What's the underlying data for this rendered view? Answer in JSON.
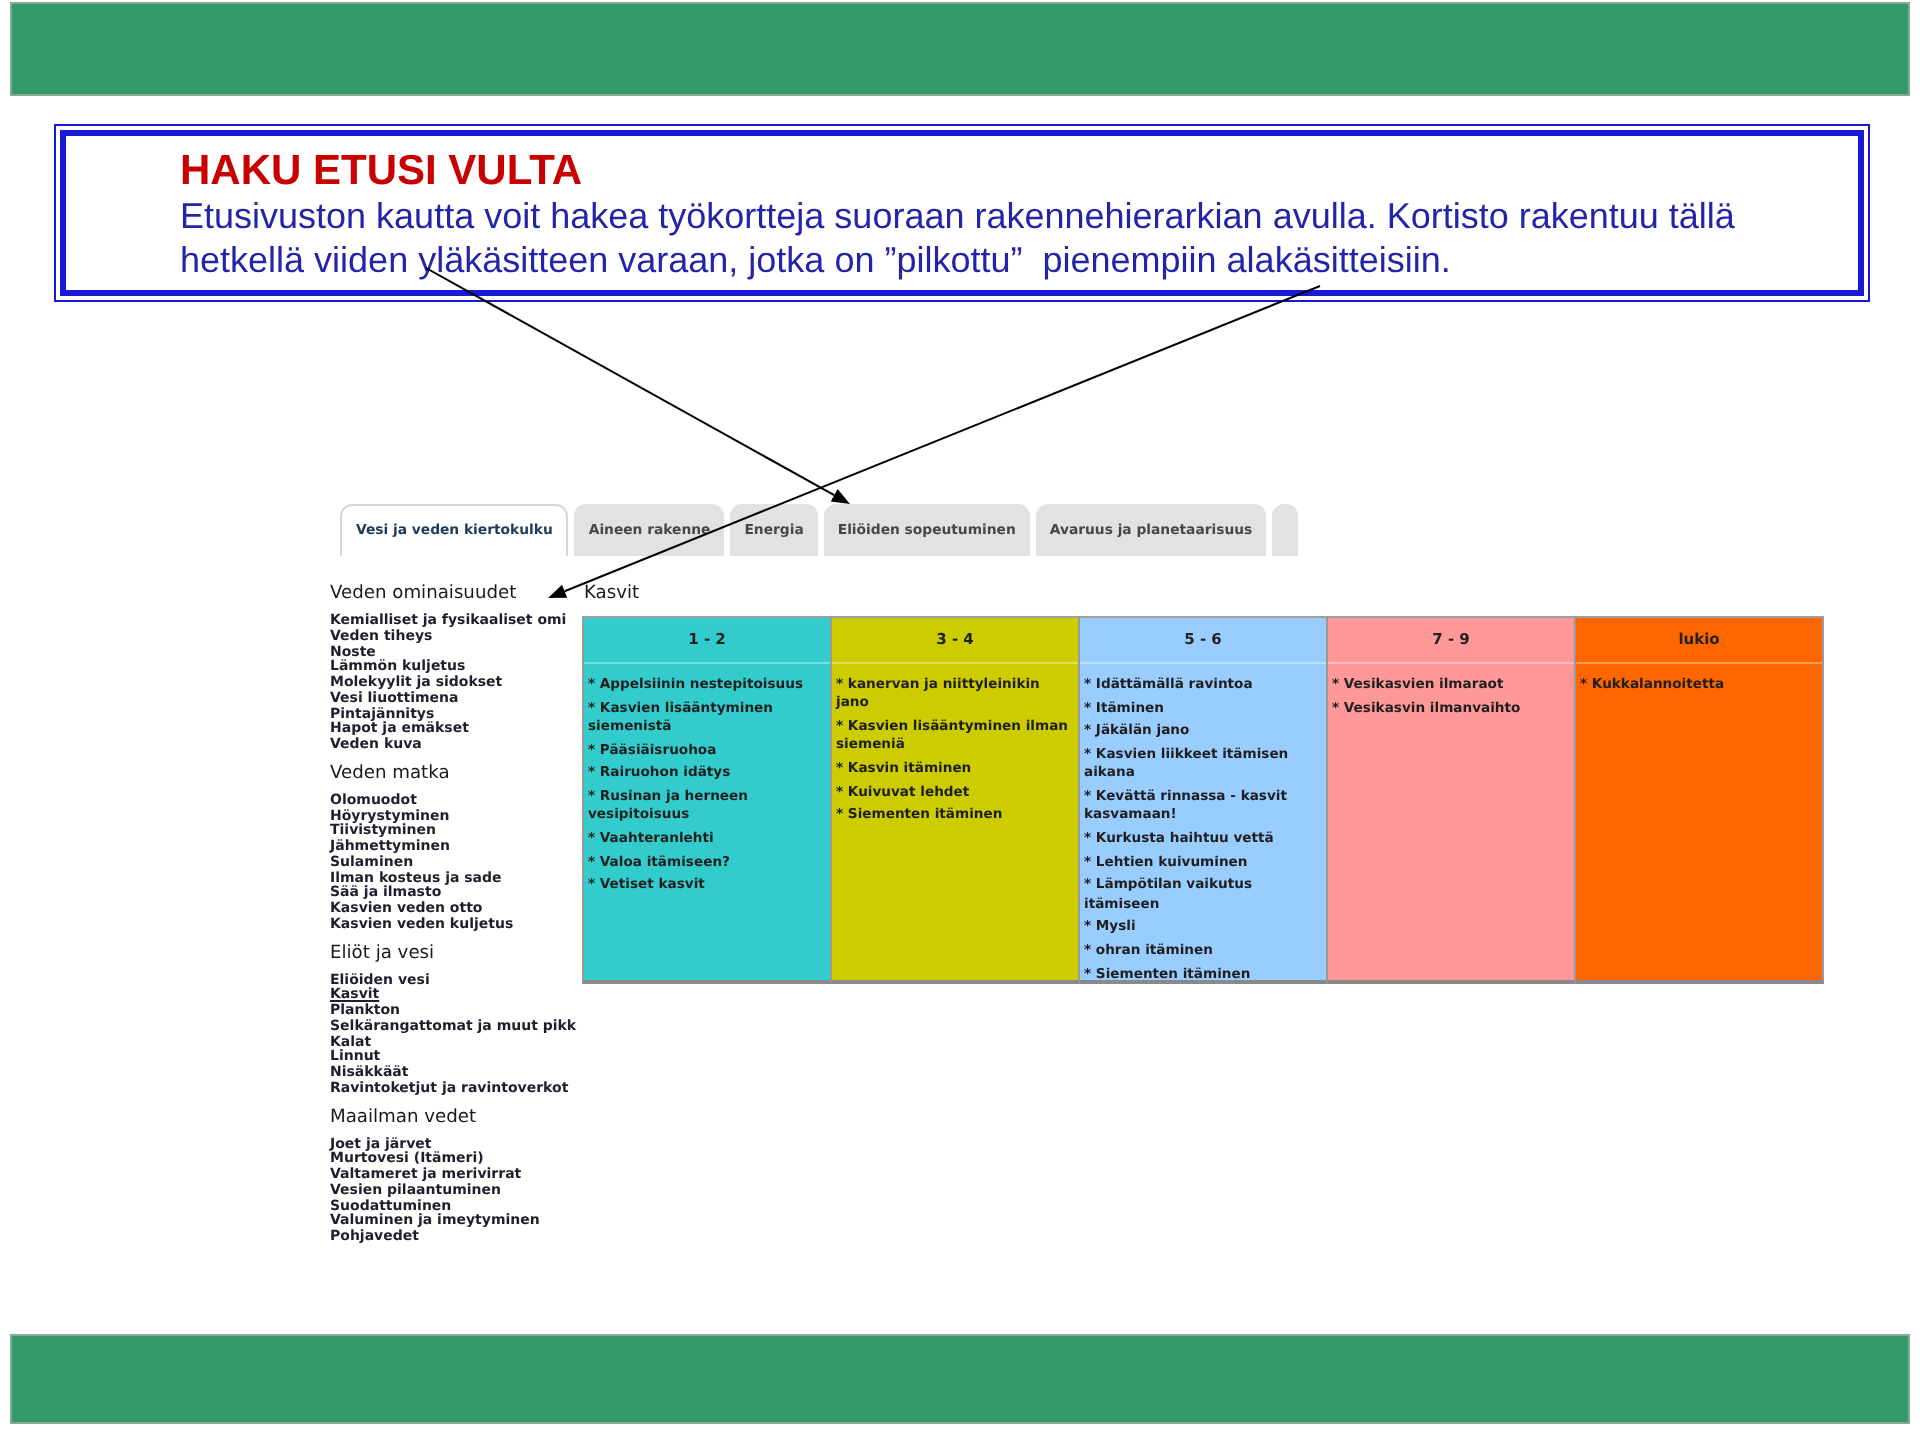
{
  "slide": {
    "title": "HAKU ETUSI VULTA",
    "text": "Etusivuston kautta voit hakea työkortteja suoraan rakennehierarkian avulla. Kortisto rakentuu tällä hetkellä viiden yläkäsitteen varaan, jotka on ”pilkottu”  pienempiin alakäsitteisiin."
  },
  "screenshot": {
    "tabs": [
      {
        "kind": "tab",
        "label": "Vesi ja veden kiertokulku",
        "selected": true
      },
      {
        "kind": "tab",
        "label": "Aineen rakenne",
        "selected": false
      },
      {
        "kind": "tab",
        "label": "Energia",
        "selected": false
      },
      {
        "kind": "tab",
        "label": "Eliöiden sopeutuminen",
        "selected": false
      },
      {
        "kind": "tab",
        "label": "Avaruus ja planetaarisuus",
        "selected": false
      },
      {
        "kind": "cut",
        "selected": false
      }
    ],
    "sidebar": [
      {
        "heading": "Veden ominaisuudet",
        "items": [
          {
            "label": "Kemialliset ja fysikaaliset omi",
            "selected": false
          },
          {
            "label": "Veden tiheys",
            "selected": false
          },
          {
            "label": "Noste",
            "selected": false
          },
          {
            "label": "Lämmön kuljetus",
            "selected": false
          },
          {
            "label": "Molekyylit ja sidokset",
            "selected": false
          },
          {
            "label": "Vesi liuottimena",
            "selected": false
          },
          {
            "label": "Pintajännitys",
            "selected": false
          },
          {
            "label": "Hapot ja emäkset",
            "selected": false
          },
          {
            "label": "Veden kuva",
            "selected": false
          }
        ]
      },
      {
        "heading": "Veden matka",
        "items": [
          {
            "label": "Olomuodot",
            "selected": false
          },
          {
            "label": "Höyrystyminen",
            "selected": false
          },
          {
            "label": "Tiivistyminen",
            "selected": false
          },
          {
            "label": "Jähmettyminen",
            "selected": false
          },
          {
            "label": "Sulaminen",
            "selected": false
          },
          {
            "label": "Ilman kosteus ja sade",
            "selected": false
          },
          {
            "label": "Sää ja ilmasto",
            "selected": false
          },
          {
            "label": "Kasvien veden otto",
            "selected": false
          },
          {
            "label": "Kasvien veden kuljetus",
            "selected": false
          }
        ]
      },
      {
        "heading": "Eliöt ja vesi",
        "items": [
          {
            "label": "Eliöiden vesi",
            "selected": false
          },
          {
            "label": "Kasvit",
            "selected": true
          },
          {
            "label": "Plankton",
            "selected": false
          },
          {
            "label": "Selkärangattomat ja muut pikk",
            "selected": false
          },
          {
            "label": "Kalat",
            "selected": false
          },
          {
            "label": "Linnut",
            "selected": false
          },
          {
            "label": "Nisäkkäät",
            "selected": false
          },
          {
            "label": "Ravintoketjut ja ravintoverkot",
            "selected": false
          }
        ]
      },
      {
        "heading": "Maailman vedet",
        "items": [
          {
            "label": "Joet ja järvet",
            "selected": false
          },
          {
            "label": "Murtovesi (Itämeri)",
            "selected": false
          },
          {
            "label": "Valtameret ja merivirrat",
            "selected": false
          },
          {
            "label": "Vesien pilaantuminen",
            "selected": false
          },
          {
            "label": "Suodattuminen",
            "selected": false
          },
          {
            "label": "Valuminen ja imeytyminen",
            "selected": false
          },
          {
            "label": "Pohjavedet",
            "selected": false
          }
        ]
      }
    ],
    "topic": "Kasvit",
    "columns": [
      {
        "heading": "1 - 2",
        "color": "#33cccc",
        "items": [
          "* Appelsiinin nestepitoisuus",
          "* Kasvien lisääntyminen siemenistä",
          "* Pääsiäisruohoa",
          "* Rairuohon idätys",
          "* Rusinan ja herneen vesipitoisuus",
          "* Vaahteranlehti",
          "* Valoa itämiseen?",
          "* Vetiset kasvit"
        ]
      },
      {
        "heading": "3 - 4",
        "color": "#cccc00",
        "items": [
          "* kanervan ja niittyleinikin jano",
          "* Kasvien lisääntyminen ilman siemeniä",
          "* Kasvin itäminen",
          "* Kuivuvat lehdet",
          "* Siementen itäminen"
        ]
      },
      {
        "heading": "5 - 6",
        "color": "#99ccff",
        "items": [
          "* Idättämällä ravintoa",
          "* Itäminen",
          "* Jäkälän jano",
          "* Kasvien liikkeet itämisen aikana",
          "* Kevättä rinnassa - kasvit kasvamaan!",
          "* Kurkusta haihtuu vettä",
          "* Lehtien kuivuminen",
          "* Lämpötilan vaikutus itämiseen",
          "* Mysli",
          "* ohran itäminen",
          "* Siementen itäminen"
        ]
      },
      {
        "heading": "7 - 9",
        "color": "#ff9999",
        "items": [
          "* Vesikasvien ilmaraot",
          "* Vesikasvin ilmanvaihto"
        ]
      },
      {
        "heading": "lukio",
        "color": "#ff6600",
        "items": [
          "* Kukkalannoitetta"
        ]
      }
    ]
  }
}
